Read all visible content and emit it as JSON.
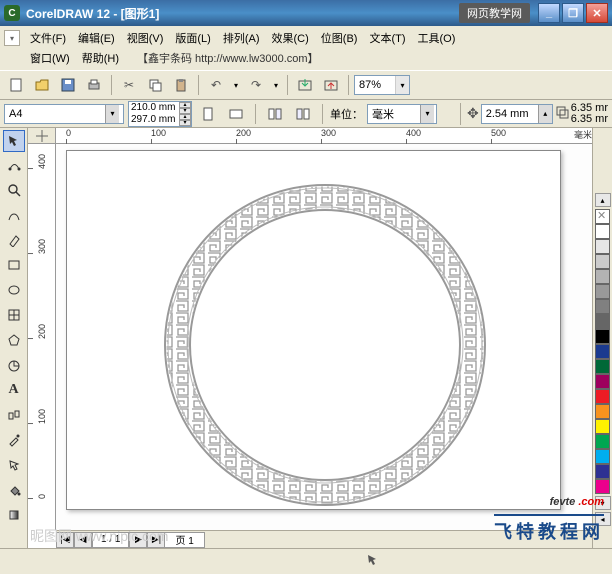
{
  "title": "CorelDRAW 12 - [图形1]",
  "brand_tag": "网页教学网",
  "menu": {
    "file": "文件(F)",
    "edit": "编辑(E)",
    "view": "视图(V)",
    "layout": "版面(L)",
    "arrange": "排列(A)",
    "effects": "效果(C)",
    "bitmaps": "位图(B)",
    "text": "文本(T)",
    "tools": "工具(O)",
    "window": "窗口(W)",
    "help": "帮助(H)"
  },
  "tagline": "【鑫宇条码  http://www.lw3000.com】",
  "zoom": "87%",
  "paper": "A4",
  "page_w": "210.0 mm",
  "page_h": "297.0 mm",
  "unit_label": "单位：",
  "unit_value": "毫米",
  "nudge": "2.54 mm",
  "dup_x": "6.35 mr",
  "dup_y": "6.35 mr",
  "ruler_unit": "毫米",
  "ruler_h": [
    "0",
    "100",
    "200",
    "300",
    "400",
    "500"
  ],
  "ruler_v": [
    "400",
    "300",
    "200",
    "100",
    "0"
  ],
  "pager": {
    "first": "|◀",
    "prev": "◀",
    "info": "1 / 1",
    "next": "▶",
    "last": "▶|",
    "tab": "页 1"
  },
  "palette_colors": [
    "#ffffff",
    "#e6e6e6",
    "#cccccc",
    "#b3b3b3",
    "#999999",
    "#808080",
    "#666666",
    "#000000",
    "#1b3a8f",
    "#006837",
    "#9e005d",
    "#ed1c24",
    "#f7931e",
    "#fff200",
    "#00a651",
    "#00aeef",
    "#2e3192",
    "#ec008c"
  ],
  "watermark": "昵图网  www.nipic.com",
  "brand": {
    "en_a": "fevte ",
    "en_b": ".com",
    "cn": "飞特教程网"
  }
}
